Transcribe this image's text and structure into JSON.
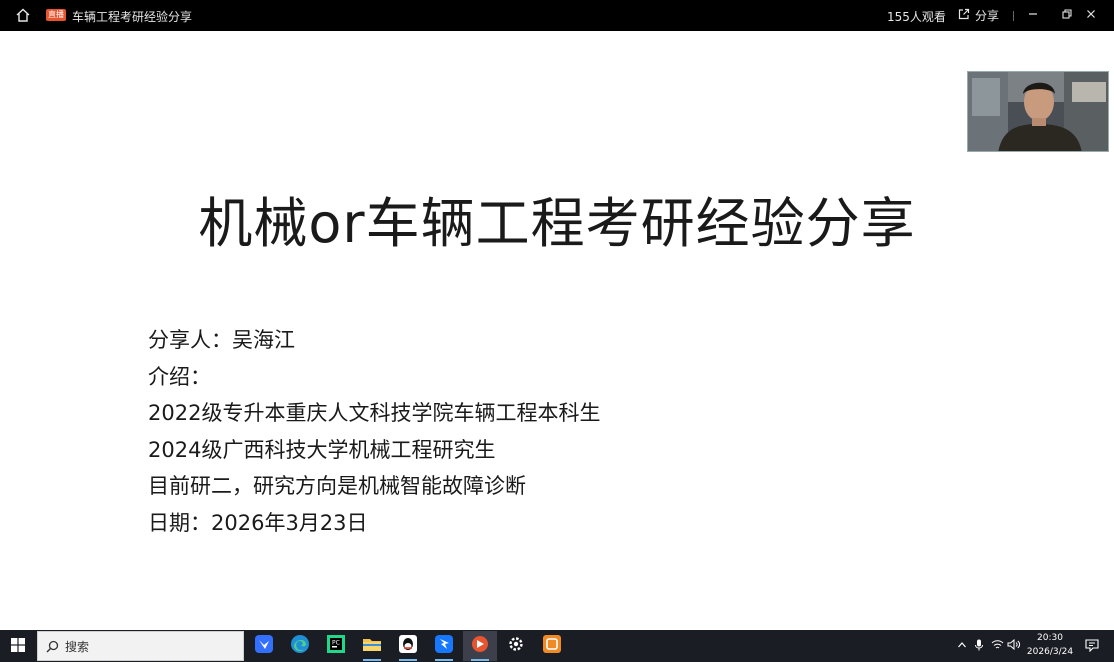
{
  "titlebar": {
    "badge": "直播",
    "title": "车辆工程考研经验分享",
    "viewers": "155人观看",
    "share_label": "分享"
  },
  "slide": {
    "title": "机械or车辆工程考研经验分享",
    "lines": [
      "分享人：吴海江",
      "介绍：",
      "2022级专升本重庆人文科技学院车辆工程本科生",
      "2024级广西科技大学机械工程研究生",
      "目前研二，研究方向是机械智能故障诊断",
      "日期：2026年3月23日"
    ]
  },
  "taskbar": {
    "search_placeholder": "搜索",
    "apps": [
      "feishu-icon",
      "edge-icon",
      "pycharm-icon",
      "file-explorer-icon",
      "qq-icon",
      "dingtalk-icon",
      "live-app-icon",
      "settings-icon",
      "notes-app-icon"
    ],
    "clock_time": "20:30",
    "clock_date": "2026/3/24"
  },
  "colors": {
    "titlebar_bg": "#000000",
    "taskbar_bg": "#1b1d24",
    "badge": "#e8542f",
    "slide_text": "#1a1a1a"
  }
}
